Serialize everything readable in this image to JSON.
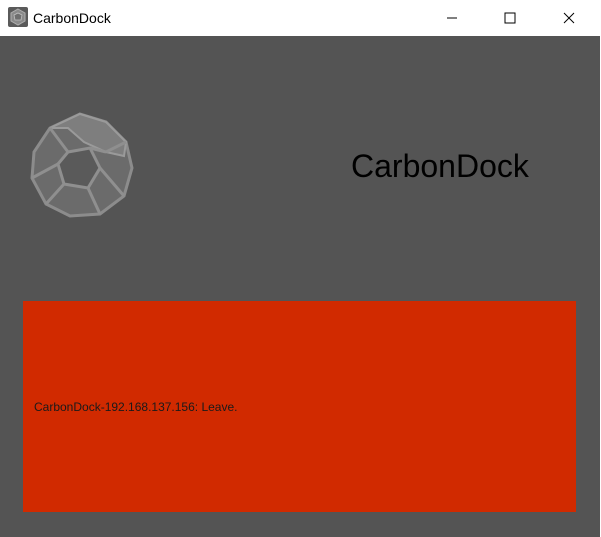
{
  "window": {
    "title": "CarbonDock",
    "icon": "carbondock-app-icon",
    "controls": {
      "minimize_icon": "minimize-icon",
      "maximize_icon": "maximize-icon",
      "close_icon": "close-icon"
    }
  },
  "main": {
    "heading": "CarbonDock",
    "logo_icon": "dodecahedron-logo-icon",
    "status": {
      "message": "CarbonDock-192.168.137.156: Leave.",
      "color": "#d12a00"
    }
  },
  "colors": {
    "client_background": "#545454",
    "titlebar_background": "#ffffff",
    "status_background": "#d12a00"
  }
}
